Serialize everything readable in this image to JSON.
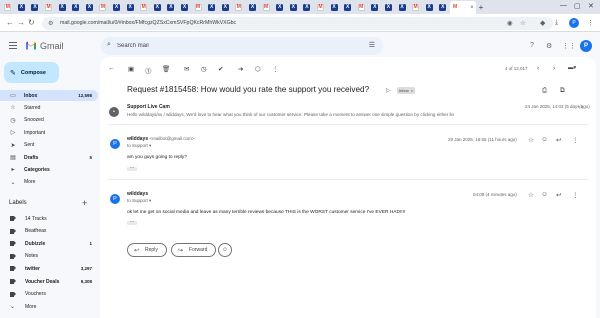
{
  "browser": {
    "tabs": [
      {
        "glyph": "M",
        "color": "#ffffff",
        "text": "#ea4335"
      },
      {
        "glyph": "X",
        "color": "#1a3c8c"
      },
      {
        "glyph": "X",
        "color": "#1a3c8c"
      },
      {
        "glyph": "M",
        "color": "#ffffff",
        "text": "#ea4335"
      },
      {
        "glyph": "X",
        "color": "#1a3c8c"
      },
      {
        "glyph": "X",
        "color": "#1a3c8c"
      },
      {
        "glyph": "X",
        "color": "#1a3c8c"
      },
      {
        "glyph": "M",
        "color": "#ffffff",
        "text": "#ea4335"
      },
      {
        "glyph": "X",
        "color": "#1a3c8c"
      },
      {
        "glyph": "X",
        "color": "#1a3c8c"
      },
      {
        "glyph": "M",
        "color": "#ffffff",
        "text": "#ea4335"
      },
      {
        "glyph": "X",
        "color": "#1a3c8c"
      },
      {
        "glyph": "X",
        "color": "#1a3c8c"
      },
      {
        "glyph": "X",
        "color": "#1a3c8c"
      },
      {
        "glyph": "M",
        "color": "#ffffff",
        "text": "#ea4335"
      },
      {
        "glyph": "X",
        "color": "#1a3c8c"
      },
      {
        "glyph": "X",
        "color": "#1a3c8c"
      },
      {
        "glyph": "M",
        "color": "#ffffff",
        "text": "#ea4335"
      },
      {
        "glyph": "X",
        "color": "#1a3c8c"
      },
      {
        "glyph": "M",
        "color": "#ffffff",
        "text": "#ea4335"
      },
      {
        "glyph": "X",
        "color": "#1a3c8c"
      },
      {
        "glyph": "X",
        "color": "#1a3c8c"
      },
      {
        "glyph": "X",
        "color": "#1a3c8c"
      },
      {
        "glyph": "M",
        "color": "#ffffff",
        "text": "#ea4335"
      },
      {
        "glyph": "X",
        "color": "#1a3c8c"
      },
      {
        "glyph": "X",
        "color": "#1a3c8c"
      },
      {
        "glyph": "M",
        "color": "#ffffff",
        "text": "#ea4335"
      },
      {
        "glyph": "X",
        "color": "#1a3c8c"
      },
      {
        "glyph": "X",
        "color": "#1a3c8c"
      },
      {
        "glyph": "X",
        "color": "#1a3c8c"
      },
      {
        "glyph": "M",
        "color": "#ffffff",
        "text": "#ea4335"
      },
      {
        "glyph": "X",
        "color": "#1a3c8c"
      },
      {
        "glyph": "X",
        "color": "#1a3c8c"
      }
    ],
    "url": "mail.google.com/mail/u/0/#inbox/FMfcgzQZSxCxmSVFpQKcRrMhWkVXGbc",
    "profile_initial": "P"
  },
  "gmail": {
    "app_name": "Gmail",
    "search_placeholder": "Search mail",
    "avatar_initial": "P",
    "compose_label": "Compose",
    "nav": [
      {
        "label": "Inbox",
        "count": "12,598",
        "icon": "inbox-icon",
        "glyph": "▭",
        "selected": true,
        "bold": true
      },
      {
        "label": "Starred",
        "count": "",
        "icon": "star-icon",
        "glyph": "☆"
      },
      {
        "label": "Snoozed",
        "count": "",
        "icon": "clock-icon",
        "glyph": "◷"
      },
      {
        "label": "Important",
        "count": "",
        "icon": "important-icon",
        "glyph": "▷"
      },
      {
        "label": "Sent",
        "count": "",
        "icon": "send-icon",
        "glyph": "➤"
      },
      {
        "label": "Drafts",
        "count": "5",
        "icon": "draft-icon",
        "glyph": "▤",
        "bold": true
      },
      {
        "label": "Categories",
        "count": "",
        "icon": "categories-icon",
        "glyph": "▸",
        "bold": true
      },
      {
        "label": "More",
        "count": "",
        "icon": "chevron-down-icon",
        "glyph": "⌄"
      }
    ],
    "labels_title": "Labels",
    "labels": [
      {
        "label": "14 Tracks",
        "count": ""
      },
      {
        "label": "Beatfreax",
        "count": ""
      },
      {
        "label": "Dubizzle",
        "count": "1",
        "bold": true
      },
      {
        "label": "Notes",
        "count": ""
      },
      {
        "label": "twitter",
        "count": "3,297",
        "bold": true
      },
      {
        "label": "Voucher Deals",
        "count": "9,308",
        "bold": true
      },
      {
        "label": "Vouchers",
        "count": ""
      },
      {
        "label": "More",
        "count": "",
        "chevron": true
      }
    ],
    "pager": "4 of 12,017",
    "subject": "Request #1815458: How would you rate the support you received?",
    "inbox_chip": "Inbox",
    "inbox_chip_x": "×",
    "messages": [
      {
        "sender": "Support Live Cam",
        "snippet": "Hello wilddays/sx / wilddays, We'd love to hear what you think of our customer service. Please take a moment to answer one simple question by clicking either lin",
        "date": "24 Jan 2025, 14:03 (5 days ago)"
      },
      {
        "sender": "wilddays",
        "email": "<mailbot@gmail.com>",
        "to": "to Support ▾",
        "date": "29 Jan 2025, 16:55 (11 hours ago)",
        "body": "am you guys going to reply?"
      },
      {
        "sender": "wilddays",
        "to": "to Support ▾",
        "date": "04:09 (4 minutes ago)",
        "body": "ok let me get on social media and leave as many terrible reviews because THIS is the WORST customer service I've EVER HAD!!!!"
      }
    ],
    "reply_label": "Reply",
    "forward_label": "Forward"
  }
}
